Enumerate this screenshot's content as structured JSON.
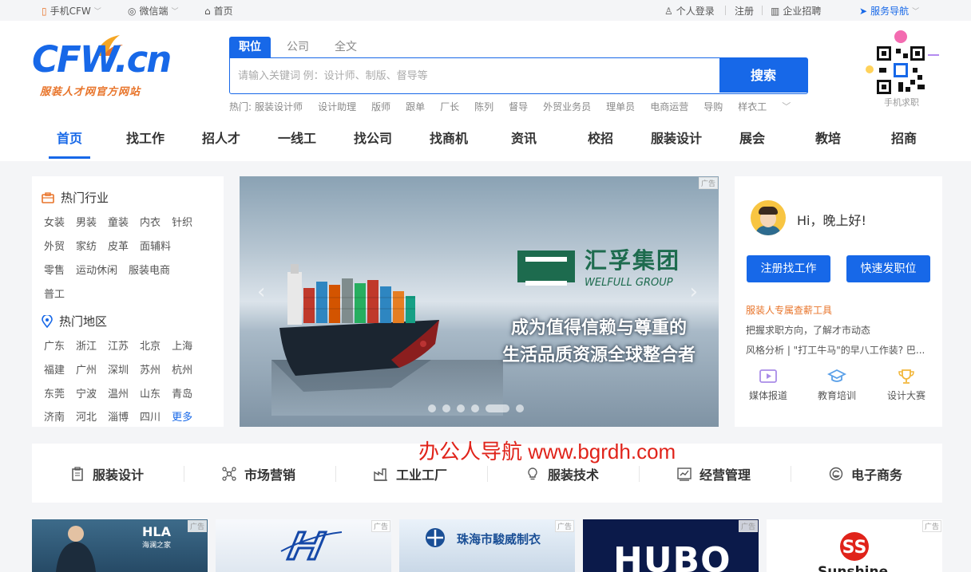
{
  "topbar": {
    "mobile": "手机CFW",
    "wechat": "微信端",
    "home": "首页",
    "login": "个人登录",
    "register": "注册",
    "employer": "企业招聘",
    "service": "服务导航"
  },
  "logo": {
    "main": "CFW.cn",
    "sub": "服装人才网官方网站"
  },
  "search": {
    "tabs": [
      "职位",
      "公司",
      "全文"
    ],
    "placeholder": "请输入关键词 例：设计师、制版、督导等",
    "button": "搜索",
    "hot_prefix": "热门:",
    "hot": [
      "服装设计师",
      "设计助理",
      "版师",
      "跟单",
      "厂长",
      "陈列",
      "督导",
      "外贸业务员",
      "理单员",
      "电商运营",
      "导购",
      "样衣工"
    ]
  },
  "qr": {
    "label": "手机求职"
  },
  "nav": [
    "首页",
    "找工作",
    "招人才",
    "一线工",
    "找公司",
    "找商机",
    "资讯",
    "校招",
    "服装设计",
    "展会",
    "教培",
    "招商"
  ],
  "left": {
    "industry_title": "热门行业",
    "industry_rows": [
      [
        "女装",
        "男装",
        "童装",
        "内衣",
        "针织"
      ],
      [
        "外贸",
        "家纺",
        "皮革",
        "面辅料"
      ],
      [
        "零售",
        "运动休闲",
        "服装电商"
      ],
      [
        "普工"
      ]
    ],
    "region_title": "热门地区",
    "region_rows": [
      [
        "广东",
        "浙江",
        "江苏",
        "北京",
        "上海"
      ],
      [
        "福建",
        "广州",
        "深圳",
        "苏州",
        "杭州"
      ],
      [
        "东莞",
        "宁波",
        "温州",
        "山东",
        "青岛"
      ],
      [
        "济南",
        "河北",
        "淄博",
        "四川"
      ]
    ],
    "more": "更多"
  },
  "banner": {
    "ad": "广告",
    "brand_cn": "汇孚集团",
    "brand_en": "WELFULL GROUP",
    "slogan1": "成为值得信赖与尊重的",
    "slogan2": "生活品质资源全球整合者"
  },
  "right": {
    "greeting": "Hi，晚上好!",
    "btn_job": "注册找工作",
    "btn_post": "快速发职位",
    "promo": "服装人专属查薪工具",
    "line1": "把握求职方向，了解才市动态",
    "line2": "风格分析 | \"打工牛马\"的早八工作装? 巴...",
    "icons": [
      "媒体报道",
      "教育培训",
      "设计大赛"
    ]
  },
  "categories": [
    "服装设计",
    "市场营销",
    "工业工厂",
    "服装技术",
    "经营管理",
    "电子商务"
  ],
  "ads": [
    {
      "title": "HLA",
      "sub": "海澜之家",
      "tag": "广告"
    },
    {
      "title": "",
      "sub": "",
      "tag": "广告"
    },
    {
      "title": "珠海市駿威制衣",
      "sub": "",
      "tag": "广告"
    },
    {
      "title": "HUBO",
      "sub": "",
      "tag": "广告"
    },
    {
      "title": "Sunshine",
      "sub": "",
      "tag": "广告"
    }
  ],
  "watermark": "办公人导航 www.bgrdh.com",
  "colors": {
    "primary": "#1768e8",
    "accent": "#e8742a",
    "watermark": "#e0231a"
  }
}
